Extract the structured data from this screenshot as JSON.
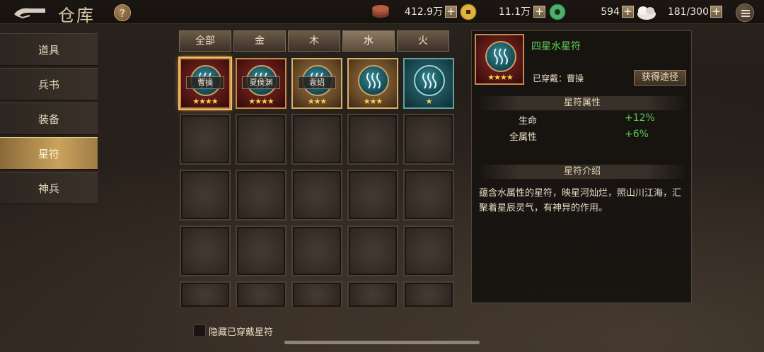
{
  "header": {
    "title": "仓库",
    "help_label": "?",
    "resources": [
      {
        "icon": "copper-coin-stack-icon",
        "value": "412.9万"
      },
      {
        "icon": "gold-coin-icon",
        "value": "11.1万"
      },
      {
        "icon": "jade-icon",
        "value": "594"
      },
      {
        "icon": "rice-sack-icon",
        "value": "181/300"
      }
    ],
    "plus_label": "+"
  },
  "sidebar": {
    "items": [
      {
        "label": "道具",
        "active": false
      },
      {
        "label": "兵书",
        "active": false
      },
      {
        "label": "装备",
        "active": false
      },
      {
        "label": "星符",
        "active": true
      },
      {
        "label": "神兵",
        "active": false
      }
    ]
  },
  "tabs": [
    {
      "label": "全部",
      "active": false
    },
    {
      "label": "金",
      "active": false
    },
    {
      "label": "木",
      "active": false
    },
    {
      "label": "水",
      "active": true
    },
    {
      "label": "火",
      "active": false
    }
  ],
  "items": [
    {
      "rarity": "red",
      "stars": "★★★★",
      "owner": "曹操",
      "selected": true
    },
    {
      "rarity": "red",
      "stars": "★★★★",
      "owner": "夏侯渊",
      "selected": false
    },
    {
      "rarity": "gold",
      "stars": "★★★",
      "owner": "袁绍",
      "selected": false
    },
    {
      "rarity": "gold",
      "stars": "★★★",
      "owner": "",
      "selected": false
    },
    {
      "rarity": "blue",
      "stars": "★",
      "owner": "",
      "selected": false
    }
  ],
  "hide_equipped_label": "隐藏已穿戴星符",
  "detail": {
    "name": "四星水星符",
    "stars": "★★★★",
    "equipped_text": "已穿戴：曹操",
    "obtain_label": "获得途径",
    "attributes_title": "星符属性",
    "attributes": [
      {
        "name": "生命",
        "value": "+12%"
      },
      {
        "name": "全属性",
        "value": "+6%"
      }
    ],
    "intro_title": "星符介绍",
    "intro_text": "蕴含水属性的星符，映星河灿烂，照山川江海，汇聚着星辰灵气，有神异的作用。"
  },
  "colors": {
    "accent_gold": "#c9a35c",
    "attr_green": "#58c957",
    "name_green": "#5fd35b"
  }
}
